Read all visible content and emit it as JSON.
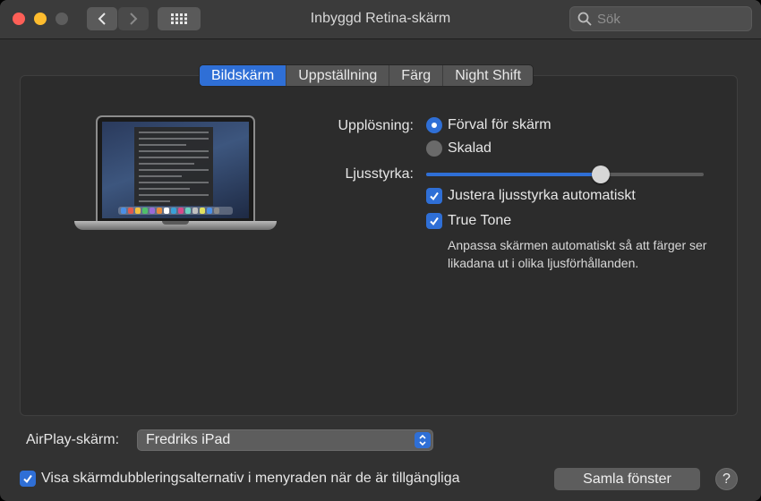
{
  "window": {
    "title": "Inbyggd Retina-skärm"
  },
  "toolbar": {
    "back_icon": "chevron-left-icon",
    "forward_icon": "chevron-right-icon",
    "show_all_icon": "grid-icon"
  },
  "search": {
    "placeholder": "Sök",
    "value": ""
  },
  "tabs": [
    {
      "label": "Bildskärm",
      "active": true
    },
    {
      "label": "Uppställning",
      "active": false
    },
    {
      "label": "Färg",
      "active": false
    },
    {
      "label": "Night Shift",
      "active": false
    }
  ],
  "display": {
    "resolution_label": "Upplösning:",
    "resolution_options": [
      {
        "label": "Förval för skärm",
        "selected": true
      },
      {
        "label": "Skalad",
        "selected": false
      }
    ],
    "brightness_label": "Ljusstyrka:",
    "brightness_level": 0.63,
    "auto_brightness": {
      "label": "Justera ljusstyrka automatiskt",
      "checked": true
    },
    "true_tone": {
      "label": "True Tone",
      "checked": true
    },
    "true_tone_description": "Anpassa skärmen automatiskt så att färger ser likadana ut i olika ljusförhållanden."
  },
  "airplay": {
    "label": "AirPlay-skärm:",
    "selected": "Fredriks iPad"
  },
  "mirroring": {
    "label": "Visa skärmdubbleringsalternativ i menyraden när de är tillgängliga",
    "checked": true
  },
  "buttons": {
    "gather_windows": "Samla fönster",
    "help": "?"
  },
  "colors": {
    "accent": "#2f6fd6",
    "window_bg": "#323232",
    "panel_bg": "#2c2c2c"
  }
}
